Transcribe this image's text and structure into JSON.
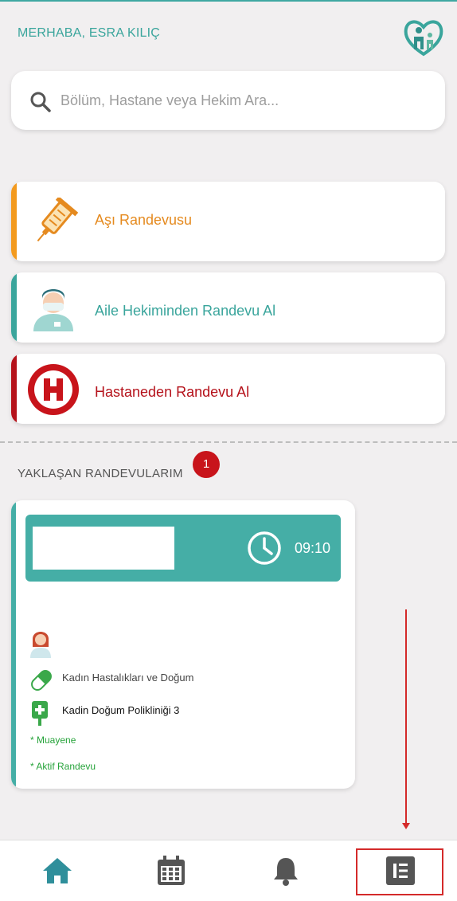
{
  "header": {
    "greeting": "MERHABA, ESRA KILIÇ",
    "logo_icon": "family-heart-logo"
  },
  "search": {
    "placeholder": "Bölüm, Hastane veya Hekim Ara..."
  },
  "menu": [
    {
      "label": "Aşı Randevusu",
      "color": "#e58a1f",
      "icon": "syringe-icon"
    },
    {
      "label": "Aile Hekiminden Randevu Al",
      "color": "#3aa59c",
      "icon": "doctor-icon"
    },
    {
      "label": "Hastaneden Randevu Al",
      "color": "#b5121b",
      "icon": "hospital-h-icon"
    }
  ],
  "upcoming": {
    "title": "YAKLAŞAN RANDEVULARIM",
    "count": "1",
    "appointment": {
      "time": "09:10",
      "department": "Kadın Hastalıkları ve Doğum",
      "clinic": "Kadin Doğum Polikliniği 3",
      "type": "* Muayene",
      "status": "* Aktif Randevu"
    }
  },
  "nav": {
    "items": [
      {
        "name": "home",
        "icon": "home-icon"
      },
      {
        "name": "calendar",
        "icon": "calendar-icon"
      },
      {
        "name": "notifications",
        "icon": "bell-icon"
      },
      {
        "name": "menu",
        "icon": "menu-list-icon"
      }
    ]
  },
  "colors": {
    "accent": "#3aa59c",
    "orange": "#e58a1f",
    "red": "#b5121b"
  }
}
